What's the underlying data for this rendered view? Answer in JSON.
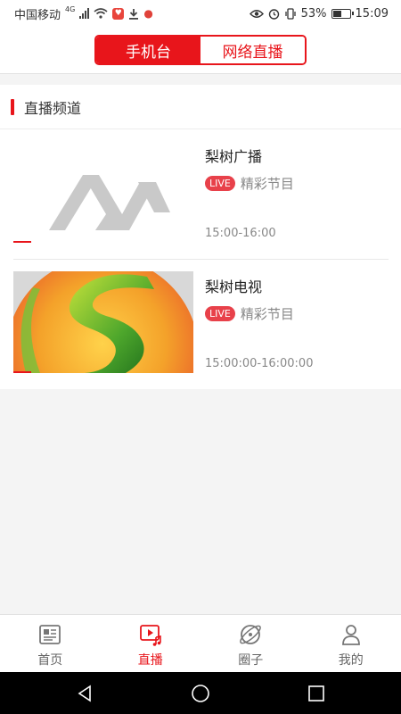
{
  "status_bar": {
    "carrier": "中国移动",
    "net_type": "4G",
    "battery_pct": "53%",
    "time": "15:09"
  },
  "top_tabs": [
    {
      "label": "手机台",
      "active": true
    },
    {
      "label": "网络直播",
      "active": false
    }
  ],
  "section": {
    "title": "直播频道",
    "channels": [
      {
        "name": "梨树广播",
        "badge": "LIVE",
        "program": "精彩节目",
        "time": "15:00-16:00"
      },
      {
        "name": "梨树电视",
        "badge": "LIVE",
        "program": "精彩节目",
        "time": "15:00:00-16:00:00"
      }
    ]
  },
  "bottom_nav": [
    {
      "label": "首页",
      "icon": "news-icon",
      "active": false
    },
    {
      "label": "直播",
      "icon": "live-video-icon",
      "active": true
    },
    {
      "label": "圈子",
      "icon": "planet-icon",
      "active": false
    },
    {
      "label": "我的",
      "icon": "person-icon",
      "active": false
    }
  ],
  "colors": {
    "accent": "#e8151b",
    "live_badge": "#e8414a"
  }
}
